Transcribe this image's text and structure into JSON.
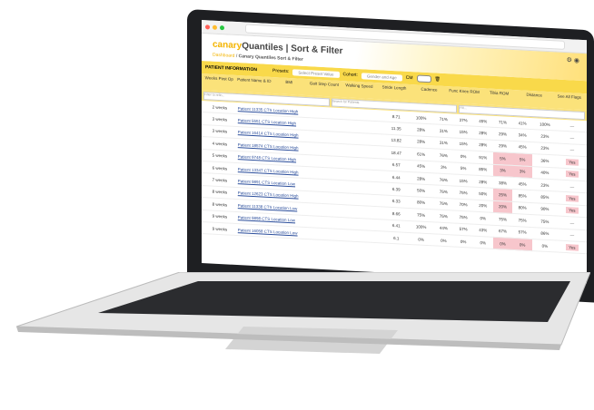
{
  "app": {
    "brand": "canary",
    "brand2": "Quantiles",
    "title": "Sort & Filter",
    "breadcrumb_home": "Dashboard",
    "breadcrumb_page": "Canary Quantiles Sort & Filter"
  },
  "toolbar": {
    "section": "PATIENT INFORMATION",
    "presets_label": "Presets:",
    "presets_placeholder": "Select Preset Value",
    "cohort_label": "Cohort:",
    "cohort_value": "Gender and Age",
    "toggle_label": "CM"
  },
  "columns": [
    "Weeks Post Op",
    "Patient Name & ID",
    "BMI",
    "Gait Step Count",
    "Walking Speed",
    "Stride Length",
    "Cadence",
    "Func Knee ROM",
    "Tibia ROM",
    "Distance",
    "See All Flags"
  ],
  "filters": [
    "Filter to refin...",
    "Search for Patients",
    "Fill..."
  ],
  "rows": [
    {
      "weeks": "2 weeks",
      "name": "Patient 11335",
      "sub": "CTS Location High",
      "bmi": "8.71",
      "c": [
        "100%",
        "71%",
        "37%",
        "45%",
        "71%",
        "41%",
        "100%"
      ],
      "flag": "—"
    },
    {
      "weeks": "3 weeks",
      "name": "Patient 5551",
      "sub": "CTS Location High",
      "bmi": "11.35",
      "c": [
        "28%",
        "31%",
        "15%",
        "28%",
        "29%",
        "34%",
        "23%"
      ],
      "flag": "—"
    },
    {
      "weeks": "3 weeks",
      "name": "Patient 16414",
      "sub": "CTS Location High",
      "bmi": "13.82",
      "c": [
        "28%",
        "31%",
        "15%",
        "28%",
        "29%",
        "45%",
        "23%"
      ],
      "flag": "—"
    },
    {
      "weeks": "4 weeks",
      "name": "Patient 18574",
      "sub": "CTS Location High",
      "bmi": "18.47",
      "c": [
        "61%",
        "76%",
        "0%",
        "91%",
        "5%",
        "5%",
        "36%"
      ],
      "flag": "Yes"
    },
    {
      "weeks": "5 weeks",
      "name": "Patient 9748",
      "sub": "CTS Location High",
      "bmi": "6.57",
      "c": [
        "45%",
        "3%",
        "5%",
        "85%",
        "3%",
        "3%",
        "40%"
      ],
      "flag": "Yes"
    },
    {
      "weeks": "6 weeks",
      "name": "Patient 13347",
      "sub": "CTS Location High",
      "bmi": "6.44",
      "c": [
        "28%",
        "76%",
        "15%",
        "28%",
        "38%",
        "45%",
        "23%"
      ],
      "flag": "—"
    },
    {
      "weeks": "7 weeks",
      "name": "Patient 9891",
      "sub": "CTS Location Low",
      "bmi": "6.39",
      "c": [
        "50%",
        "75%",
        "75%",
        "50%",
        "25%",
        "85%",
        "85%"
      ],
      "flag": "Yes"
    },
    {
      "weeks": "8 weeks",
      "name": "Patient 12623",
      "sub": "CTS Location High",
      "bmi": "6.33",
      "c": [
        "80%",
        "75%",
        "70%",
        "20%",
        "20%",
        "80%",
        "90%"
      ],
      "flag": "Yes"
    },
    {
      "weeks": "8 weeks",
      "name": "Patient 11338",
      "sub": "CTS Location Low",
      "bmi": "8.66",
      "c": [
        "75%",
        "75%",
        "75%",
        "0%",
        "75%",
        "75%",
        "75%"
      ],
      "flag": "—"
    },
    {
      "weeks": "9 weeks",
      "name": "Patient 9898",
      "sub": "CTS Location Low",
      "bmi": "6.41",
      "c": [
        "100%",
        "44%",
        "57%",
        "43%",
        "67%",
        "57%",
        "86%"
      ],
      "flag": "—"
    },
    {
      "weeks": "9 weeks",
      "name": "Patient 16058",
      "sub": "CTS Location Low",
      "bmi": "6.1",
      "c": [
        "0%",
        "0%",
        "0%",
        "0%",
        "0%",
        "0%",
        "0%"
      ],
      "flag": "Yes"
    }
  ],
  "pink_cells": [
    [
      3,
      4
    ],
    [
      3,
      5
    ],
    [
      4,
      4
    ],
    [
      4,
      5
    ],
    [
      6,
      4
    ],
    [
      7,
      4
    ],
    [
      10,
      4
    ],
    [
      10,
      5
    ]
  ]
}
